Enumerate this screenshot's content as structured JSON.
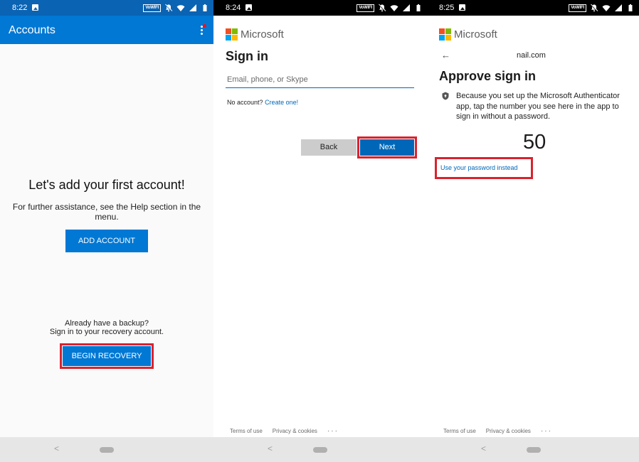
{
  "panel1": {
    "status": {
      "time": "8:22",
      "vowifi": "VoWIFI"
    },
    "appbar": {
      "title": "Accounts"
    },
    "headline": "Let's add your first account!",
    "help_text": "For further assistance, see the Help section in the menu.",
    "add_account": "ADD ACCOUNT",
    "backup_line1": "Already have a backup?",
    "backup_line2": "Sign in to your recovery account.",
    "begin_recovery": "BEGIN RECOVERY"
  },
  "panel2": {
    "status": {
      "time": "8:24",
      "vowifi": "VoWIFI"
    },
    "brand": "Microsoft",
    "title": "Sign in",
    "email_placeholder": "Email, phone, or Skype",
    "no_account": "No account?",
    "create_link": "Create one!",
    "back": "Back",
    "next": "Next",
    "footer": {
      "terms": "Terms of use",
      "privacy": "Privacy & cookies",
      "more": "···"
    }
  },
  "panel3": {
    "status": {
      "time": "8:25",
      "vowifi": "VoWIFI"
    },
    "brand": "Microsoft",
    "email": "nail.com",
    "title": "Approve sign in",
    "body": "Because you set up the Microsoft Authenticator app, tap the number you see here in the app to sign in without a password.",
    "number": "50",
    "use_password": "Use your password instead",
    "footer": {
      "terms": "Terms of use",
      "privacy": "Privacy & cookies",
      "more": "···"
    }
  },
  "colors": {
    "accent": "#0078d4",
    "link": "#0067b8",
    "highlight": "#d9232e"
  },
  "icons": [
    "image-icon",
    "mute-icon",
    "wifi-icon",
    "signal-icon",
    "battery-icon",
    "more-vert-icon",
    "back-arrow-icon",
    "lock-icon",
    "nav-back-icon",
    "nav-home-icon"
  ]
}
